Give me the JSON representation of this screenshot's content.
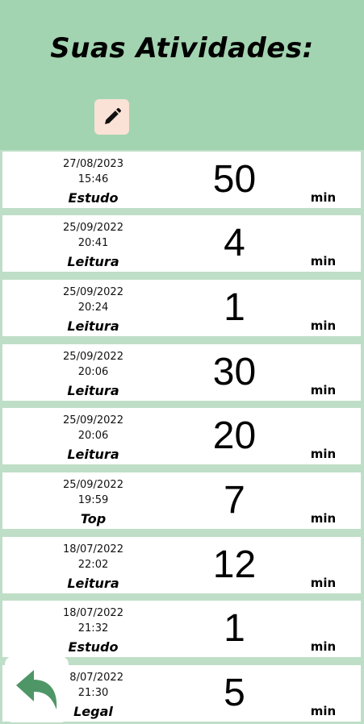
{
  "header": {
    "title": "Suas Atividades:",
    "edit_icon": "pencil-icon",
    "edit_bg": "#fbe2d7"
  },
  "colors": {
    "background": "#a3d4b1",
    "list_background": "#bfdec7",
    "back_arrow": "#4f9667"
  },
  "activities": [
    {
      "date": "27/08/2023",
      "time": "15:46",
      "type": "Estudo",
      "minutes": "50",
      "unit": "min"
    },
    {
      "date": "25/09/2022",
      "time": "20:41",
      "type": "Leitura",
      "minutes": "4",
      "unit": "min"
    },
    {
      "date": "25/09/2022",
      "time": "20:24",
      "type": "Leitura",
      "minutes": "1",
      "unit": "min"
    },
    {
      "date": "25/09/2022",
      "time": "20:06",
      "type": "Leitura",
      "minutes": "30",
      "unit": "min"
    },
    {
      "date": "25/09/2022",
      "time": "20:06",
      "type": "Leitura",
      "minutes": "20",
      "unit": "min"
    },
    {
      "date": "25/09/2022",
      "time": "19:59",
      "type": "Top",
      "minutes": "7",
      "unit": "min"
    },
    {
      "date": "18/07/2022",
      "time": "22:02",
      "type": "Leitura",
      "minutes": "12",
      "unit": "min"
    },
    {
      "date": "18/07/2022",
      "time": "21:32",
      "type": "Estudo",
      "minutes": "1",
      "unit": "min"
    },
    {
      "date": "18/07/2022",
      "time": "21:30",
      "type": "Legal",
      "minutes": "5",
      "unit": "min"
    }
  ],
  "footer": {
    "back_icon": "back-arrow-icon"
  }
}
